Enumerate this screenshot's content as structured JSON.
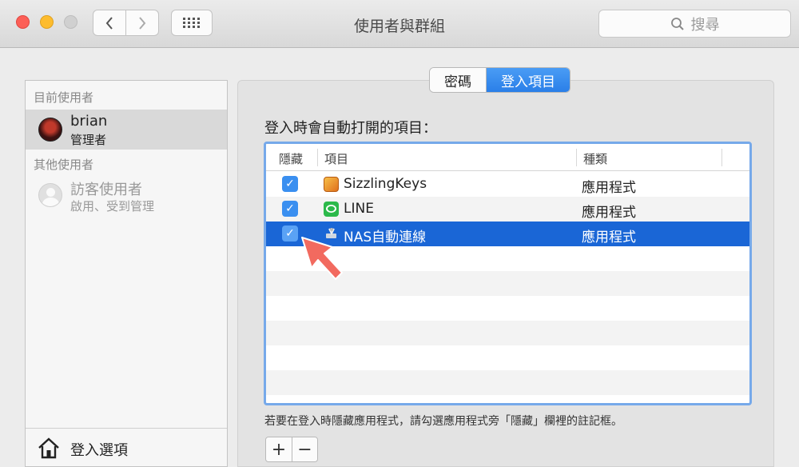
{
  "window": {
    "title": "使用者與群組"
  },
  "toolbar": {
    "search_placeholder": "搜尋"
  },
  "sidebar": {
    "current_header": "目前使用者",
    "current_user": {
      "name": "brian",
      "role": "管理者"
    },
    "other_header": "其他使用者",
    "other_user": {
      "name": "訪客使用者",
      "status": "啟用、受到管理"
    },
    "footer_label": "登入選項"
  },
  "tabs": [
    {
      "label": "密碼",
      "active": false
    },
    {
      "label": "登入項目",
      "active": true
    }
  ],
  "login_items": {
    "title": "登入時會自動打開的項目：",
    "columns": {
      "hide": "隱藏",
      "item": "項目",
      "kind": "種類"
    },
    "rows": [
      {
        "name": "SizzlingKeys",
        "kind": "應用程式",
        "hidden": true,
        "icon": "sizzlingkeys-icon",
        "selected": false
      },
      {
        "name": "LINE",
        "kind": "應用程式",
        "hidden": true,
        "icon": "line-icon",
        "selected": false
      },
      {
        "name": "NAS自動連線",
        "kind": "應用程式",
        "hidden": true,
        "icon": "script-icon",
        "selected": true
      }
    ],
    "hint": "若要在登入時隱藏應用程式，請勾選應用程式旁「隱藏」欄裡的註記框。",
    "add_label": "+",
    "remove_label": "−"
  },
  "colors": {
    "accent": "#2a7fe8",
    "selection": "#1a66d6",
    "annotation_arrow": "#f26a5f"
  }
}
